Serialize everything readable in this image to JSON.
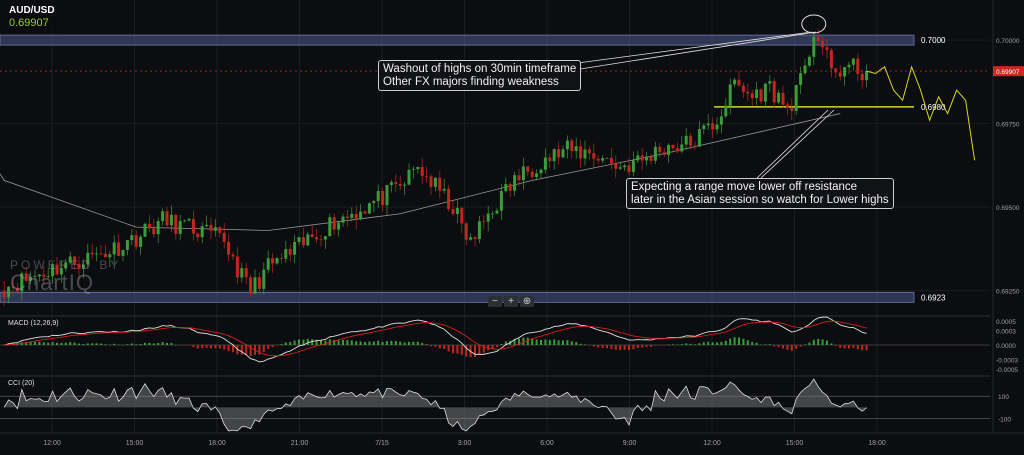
{
  "quote": {
    "symbol": "AUD/USD",
    "price": "0.69907"
  },
  "watermark": {
    "line1": "POWERED BY",
    "line2": "ChartIQ"
  },
  "zoom": {
    "out": "−",
    "in": "+",
    "reset": "⊕"
  },
  "annotations": {
    "top_note": [
      "Washout of highs on 30min timeframe",
      "Other FX majors finding weakness"
    ],
    "bottom_note": [
      "Expecting a range move lower off resistance",
      "later in the Asian session so watch for Lower highs"
    ]
  },
  "colors": {
    "background": "#0c0d10",
    "bull": "#3a9c3a",
    "bear": "#c0281f",
    "zone": "#4a5a8a",
    "projection": "#d8d820",
    "ma": "#bdbdbd",
    "current_price": "#c8281e",
    "macd_line": "#e0e0e0",
    "signal_line": "#d0201a"
  },
  "chart_data": {
    "type": "candlestick",
    "symbol": "AUD/USD",
    "interval": "5min",
    "xaxis_labels": [
      "12:00",
      "15:00",
      "18:00",
      "21:00",
      "7/15",
      "3:00",
      "6:00",
      "9:00",
      "12:00",
      "15:00",
      "18:00"
    ],
    "price_axis_ticks": [
      "0.70000",
      "0.69750",
      "0.69500",
      "0.69250"
    ],
    "ylim": [
      0.6918,
      0.7012
    ],
    "current_price": {
      "value": 0.69907,
      "label": "0.69907"
    },
    "levels": [
      {
        "value": 0.7,
        "label": "0.7000",
        "style": "zone"
      },
      {
        "value": 0.698,
        "label": "0.6980",
        "style": "projection-line"
      },
      {
        "value": 0.6923,
        "label": "0.6923",
        "style": "zone"
      }
    ],
    "path_points": [
      [
        0,
        0.6926
      ],
      [
        12,
        0.6932
      ],
      [
        24,
        0.6937
      ],
      [
        30,
        0.6941
      ],
      [
        36,
        0.6946
      ],
      [
        44,
        0.6943
      ],
      [
        50,
        0.694
      ],
      [
        54,
        0.6929
      ],
      [
        56,
        0.6925
      ],
      [
        60,
        0.6932
      ],
      [
        66,
        0.6937
      ],
      [
        74,
        0.6945
      ],
      [
        82,
        0.695
      ],
      [
        90,
        0.6956
      ],
      [
        94,
        0.6962
      ],
      [
        98,
        0.6956
      ],
      [
        102,
        0.695
      ],
      [
        104,
        0.6944
      ],
      [
        106,
        0.6939
      ],
      [
        110,
        0.6948
      ],
      [
        116,
        0.6958
      ],
      [
        122,
        0.6964
      ],
      [
        128,
        0.6967
      ],
      [
        134,
        0.6966
      ],
      [
        140,
        0.6962
      ],
      [
        145,
        0.6964
      ],
      [
        150,
        0.6968
      ],
      [
        156,
        0.6969
      ],
      [
        162,
        0.6976
      ],
      [
        166,
        0.6987
      ],
      [
        170,
        0.6983
      ],
      [
        174,
        0.6986
      ],
      [
        178,
        0.6979
      ],
      [
        182,
        0.699
      ],
      [
        184,
        0.7003
      ],
      [
        186,
        0.6998
      ],
      [
        188,
        0.699
      ],
      [
        192,
        0.6992
      ],
      [
        196,
        0.699
      ]
    ],
    "moving_average": [
      [
        0,
        0.6958
      ],
      [
        30,
        0.6944
      ],
      [
        60,
        0.6943
      ],
      [
        90,
        0.6948
      ],
      [
        120,
        0.6958
      ],
      [
        150,
        0.6966
      ],
      [
        170,
        0.6972
      ],
      [
        190,
        0.6978
      ]
    ],
    "projection": [
      [
        0.699,
        0.6992
      ],
      [
        0.6985,
        0.6982
      ],
      [
        0.6992,
        0.6985
      ],
      [
        0.6976,
        0.6983
      ],
      [
        0.6978,
        0.6985
      ],
      [
        0.6982,
        0.6964
      ]
    ],
    "macd": {
      "label": "MACD (12,26,9)",
      "ticks": [
        "0.0005",
        "0.0003",
        "0.0000",
        "-0.0003",
        "-0.0005"
      ],
      "ylim": [
        -0.0006,
        0.0006
      ]
    },
    "cci": {
      "label": "CCI (20)",
      "ticks": [
        "100",
        "-100"
      ],
      "ylim": [
        -220,
        280
      ]
    }
  }
}
